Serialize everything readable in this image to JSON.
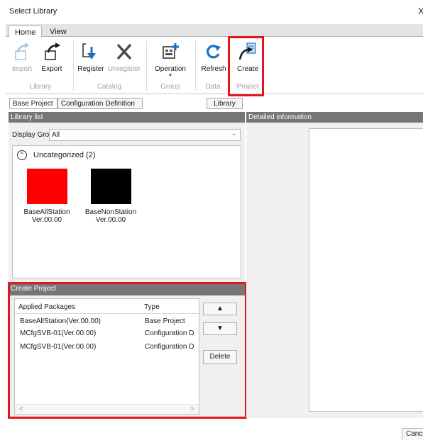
{
  "window": {
    "title": "Select Library",
    "close_glyph": "X"
  },
  "ribbon": {
    "tabs": [
      {
        "label": "Home"
      },
      {
        "label": "View"
      }
    ],
    "buttons": {
      "import": {
        "label": "Import",
        "icon": "import-icon",
        "enabled": false
      },
      "export": {
        "label": "Export",
        "icon": "export-icon",
        "enabled": true
      },
      "register": {
        "label": "Register",
        "icon": "register-icon",
        "enabled": true
      },
      "unregister": {
        "label": "Unregister",
        "icon": "unregister-icon",
        "enabled": false
      },
      "operation": {
        "label": "Operation",
        "icon": "operation-icon",
        "has_dropdown": true
      },
      "refresh": {
        "label": "Refresh",
        "icon": "refresh-icon"
      },
      "create": {
        "label": "Create",
        "icon": "create-icon"
      }
    },
    "groups": {
      "library": "Library",
      "catalog": "Catalog",
      "group": "Group",
      "data": "Data",
      "project": "Project"
    }
  },
  "doc_tabs": {
    "base_project": "Base Project",
    "configuration_definition": "Configuration Definition",
    "library": "Library"
  },
  "library_list": {
    "header": "Library list",
    "display_group_label": "Display Group :",
    "display_group_value": "All",
    "category": {
      "label": "Uncategorized (2)"
    },
    "items": [
      {
        "name": "BaseAllStation",
        "version": "Ver.00.00",
        "color": "#ff0000"
      },
      {
        "name": "BaseNonStation",
        "version": "Ver.00.00",
        "color": "#000000"
      }
    ]
  },
  "create_project": {
    "header": "Create Project",
    "columns": {
      "packages": "Applied Packages",
      "type": "Type"
    },
    "rows": [
      {
        "package": "BaseAllStation(Ver.00.00)",
        "type": "Base Project"
      },
      {
        "package": "MCfgSVB-01(Ver.00.00)",
        "type": "Configuration D"
      },
      {
        "package": "MCfgSVB-01(Ver.00.00)",
        "type": "Configuration D"
      }
    ],
    "up_glyph": "▲",
    "down_glyph": "▼",
    "delete_label": "Delete",
    "scroll_left_glyph": "<",
    "scroll_right_glyph": ">"
  },
  "detailed_information": {
    "header": "Detailed information"
  },
  "footer": {
    "cancel_label": "Cancel"
  },
  "colors": {
    "highlight": "#e2171d",
    "panel_header": "#767676",
    "accent_blue": "#1a6fc4"
  }
}
